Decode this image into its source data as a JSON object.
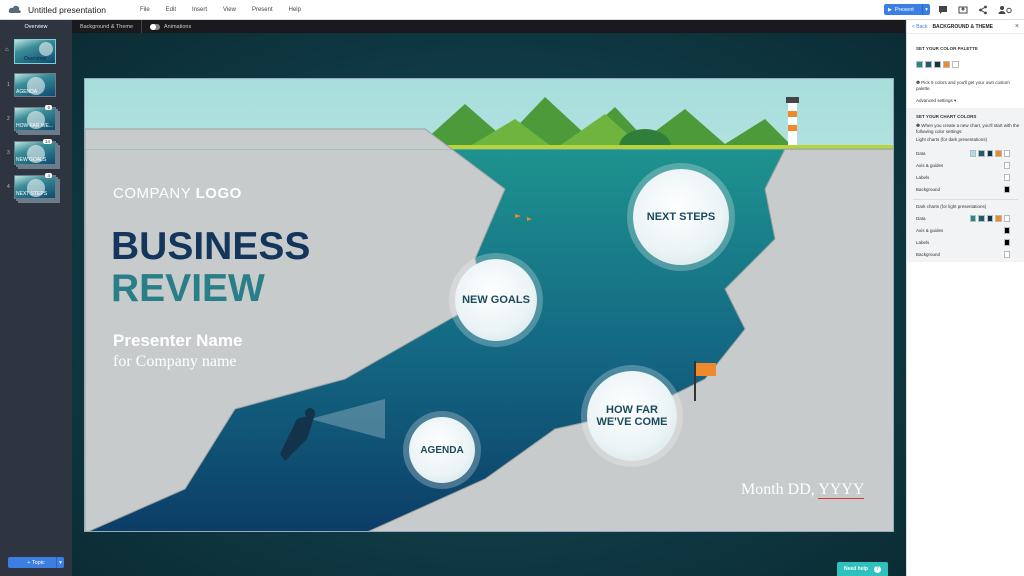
{
  "app": {
    "title": "Untitled presentation"
  },
  "menu": [
    "File",
    "Edit",
    "Insert",
    "View",
    "Present",
    "Help"
  ],
  "toolbar": {
    "present_label": "Present"
  },
  "subbar": {
    "tabs": [
      "Overview",
      "Background & Theme"
    ],
    "animations_label": "Animations"
  },
  "sidebar": {
    "items": [
      {
        "num": "",
        "label": "Overview",
        "badge": ""
      },
      {
        "num": "1",
        "label": "AGENDA",
        "badge": ""
      },
      {
        "num": "2",
        "label": "HOW FAR WE...",
        "badge": "6"
      },
      {
        "num": "3",
        "label": "NEW GOALS",
        "badge": "14"
      },
      {
        "num": "4",
        "label": "NEXT STEPS",
        "badge": "4"
      }
    ],
    "add_topic_label": "+ Topic"
  },
  "slide": {
    "company_a": "COMPANY ",
    "company_b": "LOGO",
    "title1": "BUSINESS",
    "title2": "REVIEW",
    "presenter": "Presenter Name",
    "company_name": "for Company name",
    "date_a": "Month DD, ",
    "date_b": "YYYY",
    "bubbles": {
      "next": "NEXT STEPS",
      "goals": "NEW GOALS",
      "far": "HOW FAR WE'VE COME",
      "agenda": "AGENDA"
    }
  },
  "panel": {
    "back": "< Back",
    "title": "BACKGROUND & THEME",
    "palette_title": "SET YOUR COLOR PALETTE",
    "palette": [
      "#1f8a8a",
      "#1d5c73",
      "#0f3552",
      "#ee8a2c",
      "#ffffff"
    ],
    "palette_info": "Pick 5 colors and you'll get your own custom palette.",
    "advanced": "Advanced settings ▾",
    "chart_title": "SET YOUR CHART COLORS",
    "chart_info": "When you create a new chart, you'll start with the following color settings:",
    "light_title": "Light charts (for dark presentations)",
    "light_rows": [
      {
        "label": "Data",
        "colors": [
          "#a8e0e3",
          "#1d5c73",
          "#0f3552",
          "#ee8a2c",
          "#ffffff"
        ]
      },
      {
        "label": "Axis & guides",
        "colors": [
          "#ffffff"
        ]
      },
      {
        "label": "Labels",
        "colors": [
          "#ffffff"
        ]
      },
      {
        "label": "Background",
        "colors": [
          "#000000"
        ]
      }
    ],
    "dark_title": "Dark charts (for light presentations)",
    "dark_rows": [
      {
        "label": "Data",
        "colors": [
          "#1f8a8a",
          "#1d5c73",
          "#0f3552",
          "#ee8a2c",
          "#ffffff"
        ]
      },
      {
        "label": "Axis & guides",
        "colors": [
          "#000000"
        ]
      },
      {
        "label": "Labels",
        "colors": [
          "#000000"
        ]
      },
      {
        "label": "Background",
        "colors": [
          "#ffffff"
        ]
      }
    ]
  },
  "help_label": "Need help"
}
